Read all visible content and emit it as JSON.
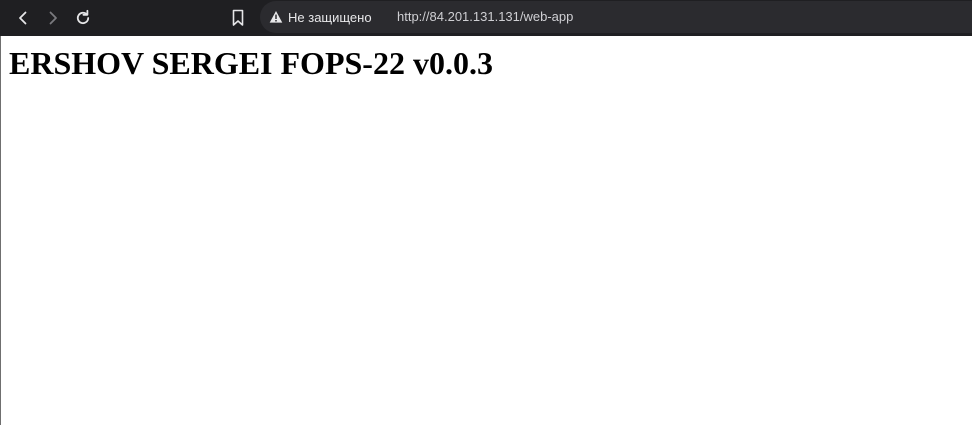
{
  "browser": {
    "security_label": "Не защищено",
    "url": "http://84.201.131.131/web-app",
    "icons": {
      "back": "chevron-left-icon",
      "forward": "chevron-right-icon",
      "reload": "reload-icon",
      "bookmark": "bookmark-icon",
      "security": "warning-triangle-icon"
    },
    "colors": {
      "toolbar_bg": "#1f1f22",
      "address_bg": "#2b2b2f",
      "text": "#e8e8ea"
    }
  },
  "page": {
    "heading": "ERSHOV SERGEI FOPS-22 v0.0.3",
    "background": "#ffffff"
  }
}
